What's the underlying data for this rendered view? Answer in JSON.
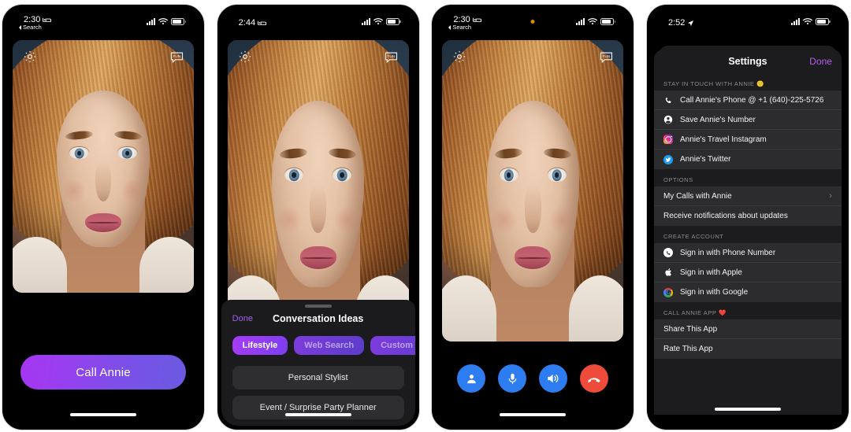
{
  "app": {
    "name": "Call Annie"
  },
  "phones": [
    {
      "id": "home",
      "status": {
        "time": "2:30",
        "back_label": "Search",
        "sleep_icon": "bed-icon",
        "wifi": "wifi-icon",
        "signal": "cellular-icon",
        "battery": "battery-icon"
      },
      "overlay": {
        "settings_icon": "gear-icon",
        "chat_icon": "chat-bubble-fun-icon"
      },
      "cta": {
        "label": "Call Annie"
      }
    },
    {
      "id": "conversation-ideas",
      "status": {
        "time": "2:44",
        "sleep_icon": "bed-icon"
      },
      "overlay": {
        "settings_icon": "gear-icon",
        "chat_icon": "chat-bubble-fun-icon"
      },
      "sheet": {
        "done_label": "Done",
        "title": "Conversation Ideas",
        "chips": [
          {
            "label": "Lifestyle",
            "active": true
          },
          {
            "label": "Web Search",
            "active": false
          },
          {
            "label": "Custom Prompt",
            "active": false
          }
        ],
        "ideas": [
          "Personal Stylist",
          "Event / Surprise Party Planner"
        ]
      }
    },
    {
      "id": "in-call",
      "status": {
        "time": "2:30",
        "back_label": "Search",
        "sleep_icon": "bed-icon",
        "recording_dot": "#e08a12"
      },
      "overlay": {
        "settings_icon": "gear-icon",
        "chat_icon": "chat-bubble-fun-icon"
      },
      "controls": [
        {
          "name": "contact-button",
          "icon": "person-icon",
          "color": "#2e7df0"
        },
        {
          "name": "mute-button",
          "icon": "microphone-icon",
          "color": "#2e7df0"
        },
        {
          "name": "speaker-button",
          "icon": "speaker-icon",
          "color": "#2e7df0"
        },
        {
          "name": "end-call-button",
          "icon": "phone-down-icon",
          "color": "#ee4b3a"
        }
      ]
    },
    {
      "id": "settings",
      "status": {
        "time": "2:52",
        "location_icon": "location-arrow-icon"
      },
      "settings": {
        "title": "Settings",
        "done_label": "Done",
        "done_color": "#b05ef0",
        "sections": [
          {
            "header": "STAY IN TOUCH WITH ANNIE 🙂",
            "rows": [
              {
                "icon": "phone-icon",
                "label": "Call Annie's Phone @ +1 (640)-225-5726"
              },
              {
                "icon": "person-circle-icon",
                "label": "Save Annie's Number"
              },
              {
                "icon": "instagram-icon",
                "label": "Annie's Travel Instagram"
              },
              {
                "icon": "twitter-icon",
                "label": "Annie's Twitter"
              }
            ]
          },
          {
            "header": "OPTIONS",
            "rows": [
              {
                "icon": null,
                "label": "My Calls with Annie",
                "chevron": "›"
              },
              {
                "icon": null,
                "label": "Receive notifications about updates"
              }
            ]
          },
          {
            "header": "CREATE ACCOUNT",
            "rows": [
              {
                "icon": "phone-circle-icon",
                "label": "Sign in with Phone Number"
              },
              {
                "icon": "apple-icon",
                "label": "Sign in with Apple"
              },
              {
                "icon": "google-icon",
                "label": "Sign in with Google"
              }
            ]
          },
          {
            "header": "CALL ANNIE APP ❤️",
            "rows": [
              {
                "icon": null,
                "label": "Share This App"
              },
              {
                "icon": null,
                "label": "Rate This App"
              }
            ]
          }
        ]
      }
    }
  ]
}
